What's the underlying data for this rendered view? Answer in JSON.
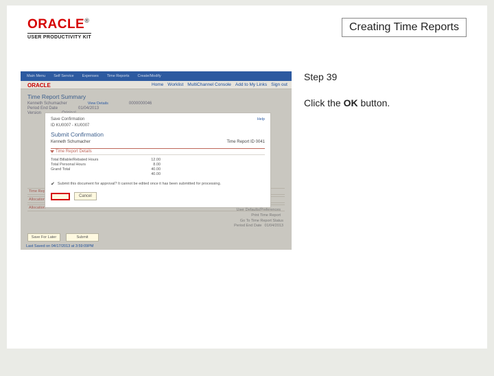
{
  "header": {
    "brand_main": "ORACLE",
    "brand_reg": "®",
    "brand_sub": "USER PRODUCTIVITY KIT",
    "doc_title": "Creating Time Reports"
  },
  "instruction": {
    "step_label": "Step 39",
    "line_prefix": "Click the ",
    "line_bold": "OK",
    "line_suffix": " button."
  },
  "shot": {
    "topnav": [
      "Main Menu",
      "Self Service",
      "Expenses",
      "Time Reports",
      "Create/Modify"
    ],
    "banner": [
      "Home",
      "Worklist",
      "MultiChannel Console",
      "Add to My Links",
      "Sign out"
    ],
    "ora_small": "ORACLE",
    "summary_title": "Time Report Summary",
    "summary_name": "Kenneth Schumacher",
    "summary_action": "View Details",
    "summary_report": "0000000046",
    "period_label": "Period End Date",
    "period_value": "01/04/2013",
    "version_label": "Version",
    "version_value": "Original",
    "modal_head": "Save Confirmation",
    "modal_help": "Help",
    "modal_sub": "ID KU0007 - KU0007",
    "modal_title": "Submit Confirmation",
    "modal_name": "Kenneth Schumacher",
    "modal_report_label": "Time Report ID",
    "modal_report_value": "0041",
    "details_bar": "Time Report Details",
    "totals": [
      {
        "label": "Total Billable/Rebated Hours",
        "value": "12.00"
      },
      {
        "label": "Total Personal Hours",
        "value": "8.00"
      },
      {
        "label": "Grand Total",
        "value": "40.00"
      },
      {
        "label": "",
        "value": "40.00"
      }
    ],
    "confirm_text": "Submit this document for approval? It cannot be edited once it has been submitted for processing.",
    "cancel": "Cancel",
    "bg_sections": [
      "Time Report Allocation",
      "Allocation",
      "Allocation"
    ],
    "footbtns": [
      "Save For Later",
      "Submit"
    ],
    "footer_right": [
      {
        "label": "User Defaults/Preferences",
        "value": ""
      },
      {
        "label": "Print Time Report",
        "value": ""
      },
      {
        "label": "",
        "value": "Go To Time Report Status"
      },
      {
        "label": "Period End Date",
        "value": "01/04/2013"
      }
    ],
    "last_saved": "Last Saved on 04/17/2013 at 3:59:09PM"
  }
}
